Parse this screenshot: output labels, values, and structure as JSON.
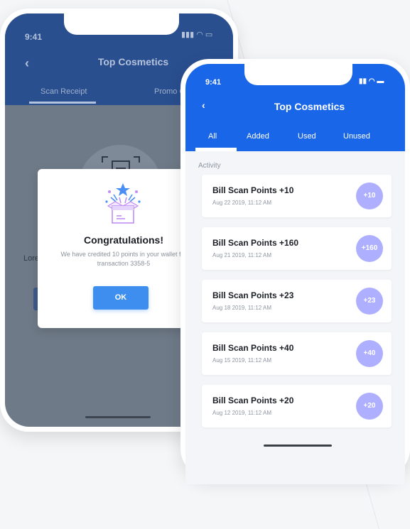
{
  "back_screen": {
    "time": "9:41",
    "title": "Top Cosmetics",
    "tabs": [
      "Scan Receipt",
      "Promo C"
    ],
    "body_text": "Lore",
    "dialog": {
      "title": "Congratulations!",
      "message": "We have credited 10 points in your wallet for transaction 3358-5",
      "ok_label": "OK"
    }
  },
  "front_screen": {
    "time": "9:41",
    "title": "Top Cosmetics",
    "tabs": [
      {
        "label": "All"
      },
      {
        "label": "Added"
      },
      {
        "label": "Used"
      },
      {
        "label": "Unused"
      }
    ],
    "selected_tab": "All",
    "section_label": "Activity",
    "items": [
      {
        "title": "Bill Scan Points +10",
        "date": "Aug 22 2019,  11:12 AM",
        "badge": "+10"
      },
      {
        "title": "Bill Scan Points +160",
        "date": "Aug 21 2019,  11:12 AM",
        "badge": "+160"
      },
      {
        "title": "Bill Scan Points +23",
        "date": "Aug 18 2019,  11:12 AM",
        "badge": "+23"
      },
      {
        "title": "Bill Scan Points +40",
        "date": "Aug 15 2019,  11:12 AM",
        "badge": "+40"
      },
      {
        "title": "Bill Scan Points +20",
        "date": "Aug 12 2019,  11:12 AM",
        "badge": "+20"
      }
    ]
  },
  "colors": {
    "primary": "#1a66e8",
    "badge": "#aeb0ff",
    "ok_button": "#3e8ef0"
  }
}
